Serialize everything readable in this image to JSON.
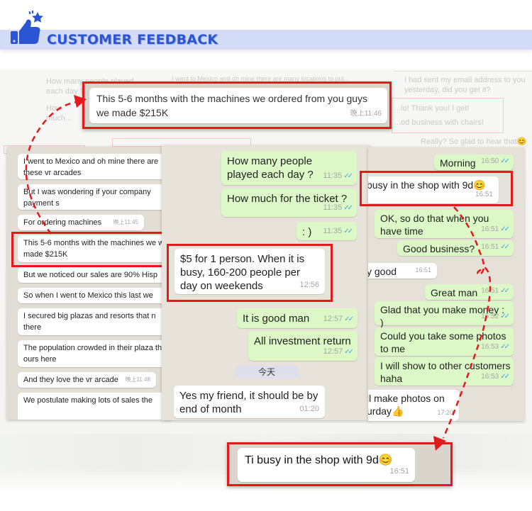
{
  "header": {
    "title": "CUSTOMER FEEDBACK",
    "icon": "thumbs-up-star-icon",
    "accent_color": "#2c55d6",
    "band_color": "#d3dcf6"
  },
  "colors": {
    "highlight_red": "#e3191b",
    "incoming_bubble": "#ffffff",
    "outgoing_bubble": "#dcf8c6",
    "read_ticks": "#4fa3e0"
  },
  "top_callout": {
    "text": "This 5-6 months with the machines we ordered from you guys we made $215K",
    "time": "晚上11:46"
  },
  "bottom_callout": {
    "text": "Ti busy in the shop with 9d😊",
    "time": "16:51"
  },
  "background_faded": {
    "left_messages": [
      "How many people played each day ?",
      "How much..."
    ],
    "center_message": "I went to Mexico and oh mine there are many locations to put...",
    "center_highlight": "This 5-6 months with the machines we ordered from you guys",
    "right_messages": [
      "I had sent my email address to you yesterday, did you get it?",
      "...lo! Thank you! I get!",
      "...od business with chairs!",
      "Really? So glad to hear that😊"
    ]
  },
  "left_chat": {
    "messages": [
      {
        "text": "I went to Mexico and oh mine there are these vr arcades",
        "time": ""
      },
      {
        "text": "But I was wondering if your company payment s",
        "time": ""
      },
      {
        "text": "For ordering machines",
        "time": "晚上11:45"
      },
      {
        "text": "This 5-6 months with the machines we we made $215K",
        "time": "",
        "highlighted": true
      },
      {
        "text": "But we noticed our sales are 90% Hisp",
        "time": ""
      },
      {
        "text": "So when I went to Mexico this last we",
        "time": ""
      },
      {
        "text": "I secured big plazas and resorts that n there",
        "time": ""
      },
      {
        "text": "The population crowded in their plaza than ours here",
        "time": ""
      },
      {
        "text": "And they love the vr arcade",
        "time": "晚上11:48"
      },
      {
        "text": "We postulate making lots of sales the",
        "time": ""
      }
    ]
  },
  "middle_chat": {
    "messages": [
      {
        "text": "How many people played each day ?",
        "time": "11:35",
        "dir": "out",
        "read": true
      },
      {
        "text": "How much for the ticket ?",
        "time": "11:35",
        "dir": "out",
        "read": true
      },
      {
        "text": ": )",
        "time": "11:35",
        "dir": "out",
        "read": true
      },
      {
        "text": "$5 for 1 person. When it is busy, 160-200 people per day on weekends",
        "time": "12:56",
        "dir": "in",
        "highlighted": true
      },
      {
        "text": "It is good man",
        "time": "12:57",
        "dir": "out",
        "read": true
      },
      {
        "text": "All investment return",
        "time": "12:57",
        "dir": "out",
        "read": true
      },
      {
        "text": "Yes my friend, it should be by end of month",
        "time": "01:20",
        "dir": "in"
      }
    ],
    "day_separator": "今天"
  },
  "right_chat": {
    "messages": [
      {
        "text": "Morning",
        "time": "16:50",
        "dir": "out",
        "read": true
      },
      {
        "text": "busy in the shop with 9d😊",
        "time": "16:51",
        "dir": "in",
        "highlighted": true
      },
      {
        "text": "OK, so do that when you have time",
        "time": "16:51",
        "dir": "out",
        "read": true
      },
      {
        "text": "Good business?",
        "time": "16:51",
        "dir": "out",
        "read": true
      },
      {
        "text": "y good",
        "time": "16:51",
        "dir": "in"
      },
      {
        "text": "Great man",
        "time": "16:51",
        "dir": "out",
        "read": true
      },
      {
        "text": "Glad that you make money : )",
        "time": "16:52",
        "dir": "out",
        "read": true
      },
      {
        "text": "Could you take some photos to me",
        "time": "16:53",
        "dir": "out",
        "read": true
      },
      {
        "text": "I will show to other customers haha",
        "time": "16:53",
        "dir": "out",
        "read": true
      },
      {
        "text": "ll make photos on urday👍",
        "time": "17:20",
        "dir": "in"
      }
    ]
  },
  "icons": {
    "read_ticks": "✓✓"
  }
}
